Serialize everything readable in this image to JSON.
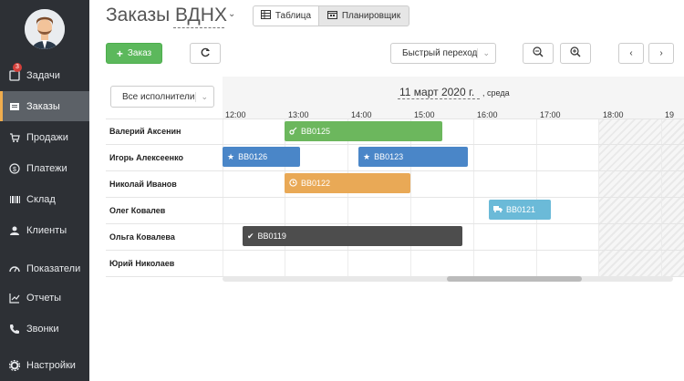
{
  "sidebar": {
    "items": [
      {
        "label": "Задачи",
        "icon": "tasks-icon",
        "badge": "3"
      },
      {
        "label": "Заказы",
        "icon": "orders-icon"
      },
      {
        "label": "Продажи",
        "icon": "cart-icon"
      },
      {
        "label": "Платежи",
        "icon": "payments-icon"
      },
      {
        "label": "Склад",
        "icon": "barcode-icon"
      },
      {
        "label": "Клиенты",
        "icon": "clients-icon"
      },
      {
        "label": "Показатели",
        "icon": "gauge-icon"
      },
      {
        "label": "Отчеты",
        "icon": "reports-icon"
      },
      {
        "label": "Звонки",
        "icon": "phone-icon"
      },
      {
        "label": "Настройки",
        "icon": "settings-icon"
      }
    ]
  },
  "header": {
    "title": "Заказы ВДНХ",
    "view_table": "Таблица",
    "view_planner": "Планировщик"
  },
  "toolbar": {
    "add_label": "Заказ",
    "quick_jump": "Быстрый переход"
  },
  "planner": {
    "filter": "Все исполнители",
    "date": "11 март 2020 г.",
    "weekday": ", среда",
    "hours": [
      "12:00",
      "13:00",
      "14:00",
      "15:00",
      "16:00",
      "17:00",
      "18:00",
      "19"
    ],
    "rows": [
      "Валерий Аксенин",
      "Игорь Алексеенко",
      "Николай Иванов",
      "Олег Ковалев",
      "Ольга Ковалева",
      "Юрий Николаев"
    ],
    "orders": [
      {
        "code": "ВВ0125",
        "color": "#6cb75d",
        "icon": "key-icon"
      },
      {
        "code": "ВВ0126",
        "color": "#4a86c8",
        "icon": "star-icon"
      },
      {
        "code": "ВВ0123",
        "color": "#4a86c8",
        "icon": "star-icon"
      },
      {
        "code": "ВВ0122",
        "color": "#e9a956",
        "icon": "clock-icon"
      },
      {
        "code": "ВВ0121",
        "color": "#6bbad8",
        "icon": "truck-icon"
      },
      {
        "code": "ВВ0119",
        "color": "#4d4d4d",
        "icon": "check-icon"
      }
    ]
  }
}
